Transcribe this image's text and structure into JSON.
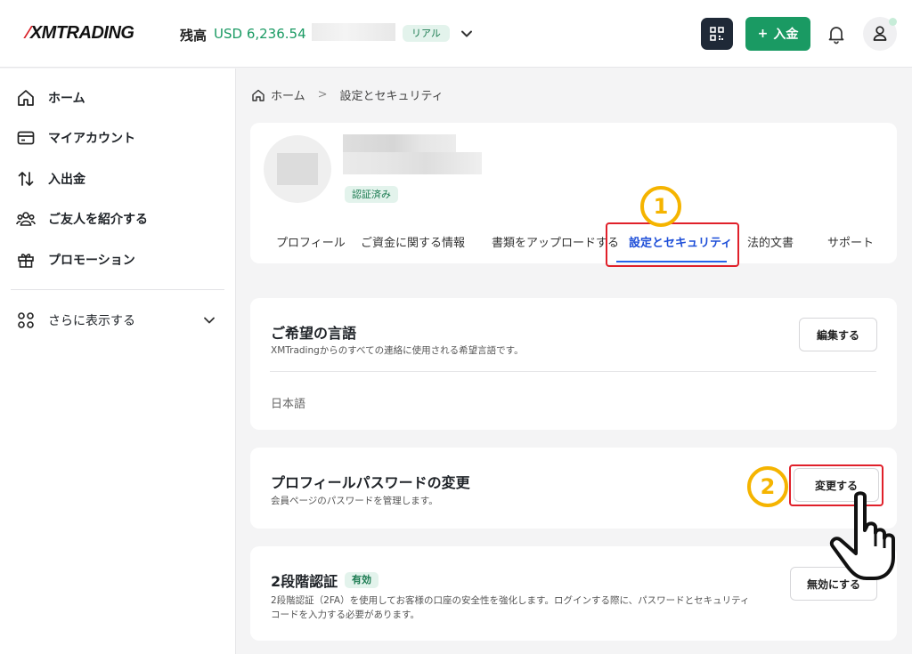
{
  "header": {
    "logo": "XMTRADING",
    "balance_label": "残高",
    "balance_value": "USD 6,236.54",
    "account_type_badge": "リアル",
    "deposit_button": "入金"
  },
  "sidebar": {
    "items": [
      {
        "label": "ホーム"
      },
      {
        "label": "マイアカウント"
      },
      {
        "label": "入出金"
      },
      {
        "label": "ご友人を紹介する"
      },
      {
        "label": "プロモーション"
      }
    ],
    "more_label": "さらに表示する"
  },
  "breadcrumb": {
    "home": "ホーム",
    "current": "設定とセキュリティ"
  },
  "profile": {
    "verified_badge": "認証済み",
    "tabs": [
      {
        "label": "プロフィール"
      },
      {
        "label": "ご資金に関する情報"
      },
      {
        "label": "書類をアップロードする"
      },
      {
        "label": "設定とセキュリティ",
        "active": true
      },
      {
        "label": "法的文書"
      },
      {
        "label": "サポート"
      }
    ]
  },
  "annotations": {
    "step1": "1",
    "step2": "2",
    "highlight_color": "#e0202a",
    "circle_color": "#f5b400"
  },
  "language_card": {
    "title": "ご希望の言語",
    "description": "XMTradingからのすべての連絡に使用される希望言語です。",
    "edit_button": "編集する",
    "value": "日本語"
  },
  "password_card": {
    "title": "プロフィールパスワードの変更",
    "description": "会員ページのパスワードを管理します。",
    "change_button": "変更する"
  },
  "twofa_card": {
    "title": "2段階認証",
    "status_badge": "有効",
    "description_line1": "2段階認証（2FA）を使用してお客様の口座の安全性を強化します。ログインする際に、パスワードとセキュリティ",
    "description_line2": "コードを入力する必要があります。",
    "disable_button": "無効にする"
  },
  "colors": {
    "brand_green": "#1a9a63",
    "brand_red": "#d81f26",
    "active_tab": "#1d4ed8"
  }
}
